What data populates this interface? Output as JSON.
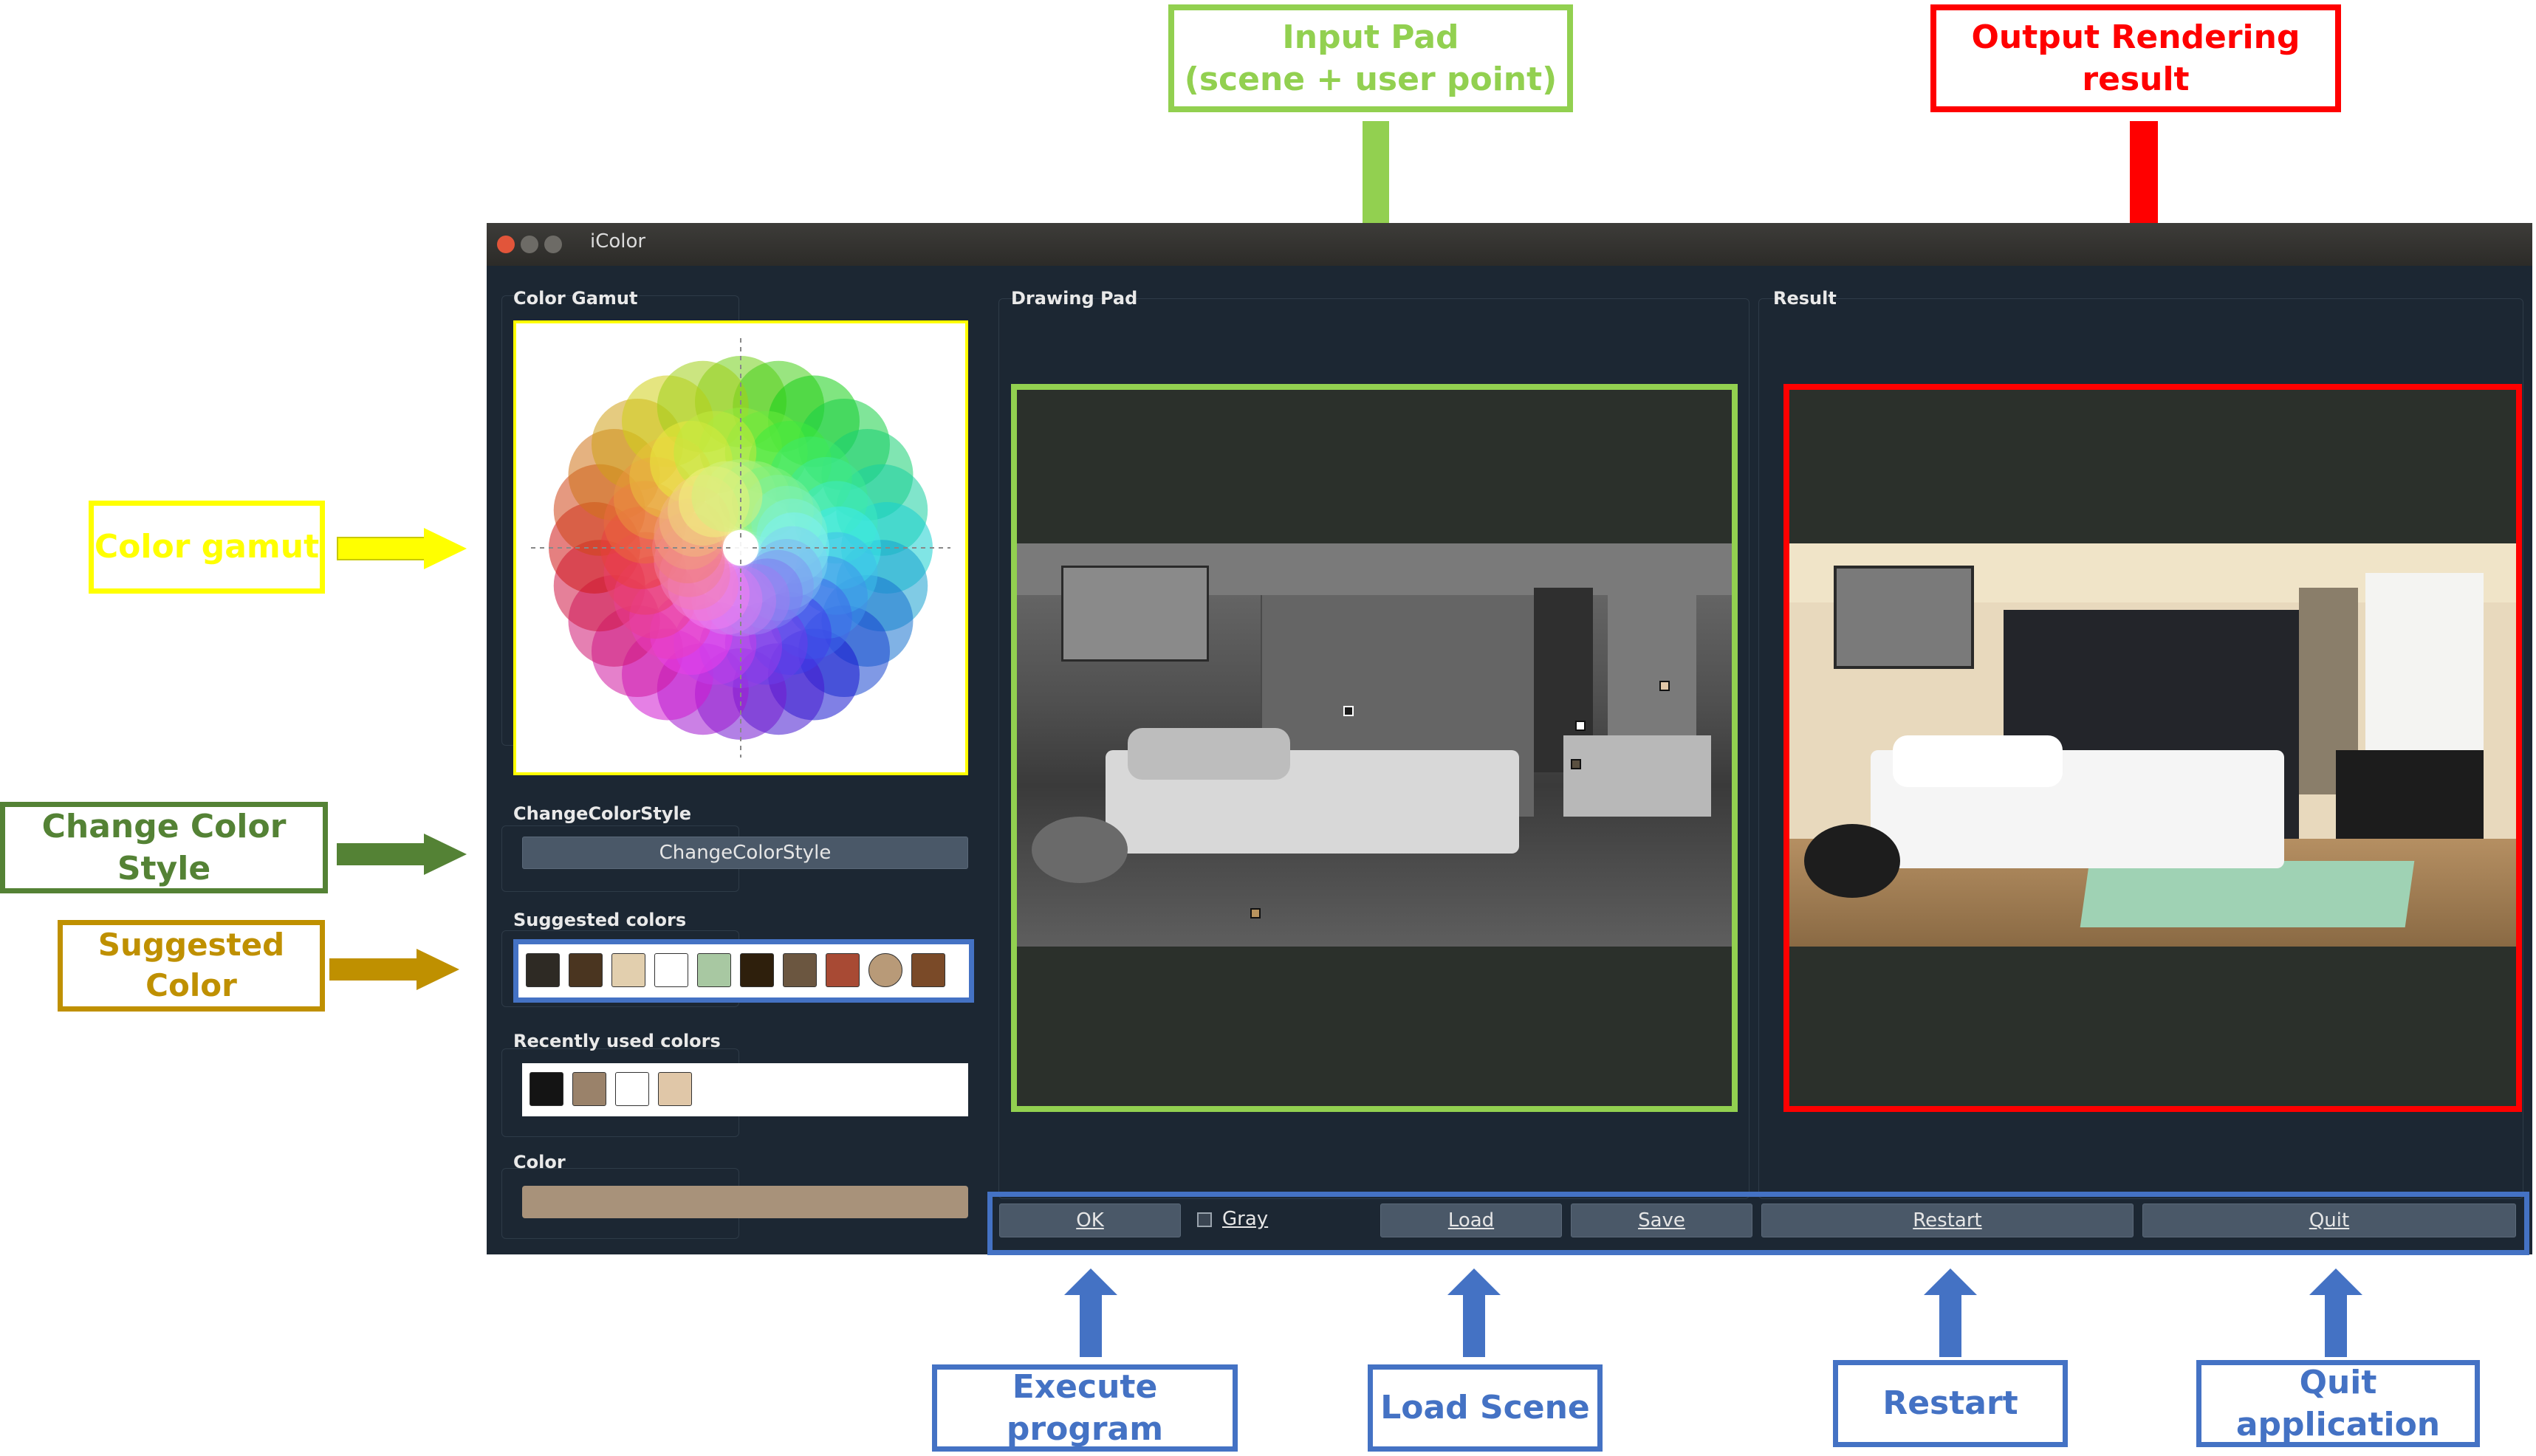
{
  "window": {
    "title": "iColor",
    "panels": {
      "color_gamut": "Color Gamut",
      "change_style": "ChangeColorStyle",
      "suggested": "Suggested colors",
      "recent": "Recently used colors",
      "color": "Color",
      "drawing_pad": "Drawing Pad",
      "result": "Result"
    },
    "change_style_button": "ChangeColorStyle",
    "suggested_colors": [
      "#2e2a24",
      "#4a3520",
      "#e2cfae",
      "#ffffff",
      "#a8c8a2",
      "#2e1f0c",
      "#6b5640",
      "#a84a34",
      "#b89a78",
      "#7a4a28"
    ],
    "recent_colors": [
      "#141414",
      "#9a826a",
      "#ffffff",
      "#e0c7a8"
    ],
    "current_color": "#a8927a",
    "buttons": {
      "ok": "OK",
      "gray": "Gray",
      "load": "Load",
      "save": "Save",
      "restart": "Restart",
      "quit": "Quit"
    }
  },
  "annotations": {
    "input_pad": "Input Pad\n(scene + user point)",
    "output": "Output Rendering result",
    "color_gamut": "Color gamut",
    "change_color_style": "Change Color Style",
    "suggested_color": "Suggested Color",
    "execute": "Execute program",
    "load_scene": "Load Scene",
    "restart": "Restart",
    "quit": "Quit application"
  },
  "colors": {
    "green": "#92d050",
    "red": "#ff0000",
    "yellow": "#ffff00",
    "dark_green": "#548235",
    "gold": "#bf9000",
    "blue": "#4472c4"
  }
}
